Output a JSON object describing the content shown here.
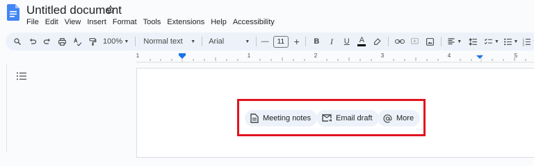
{
  "window": {
    "title": "Untitled document"
  },
  "menu": [
    "File",
    "Edit",
    "View",
    "Insert",
    "Format",
    "Tools",
    "Extensions",
    "Help",
    "Accessibility"
  ],
  "toolbar": {
    "zoom": "100%",
    "style": "Normal text",
    "font": "Arial",
    "font_size": "11",
    "minus": "—",
    "plus": "+",
    "bold": "B",
    "italic": "I",
    "underline": "U",
    "text_color": "A"
  },
  "ruler": {
    "labels": [
      "1",
      "1",
      "2",
      "3",
      "4",
      "5",
      "6"
    ]
  },
  "chips": {
    "meeting_notes": "Meeting notes",
    "email_draft": "Email draft",
    "more": "More"
  },
  "colors": {
    "accent": "#1a73e8",
    "highlight_box": "#e0141e",
    "toolbar_bg": "#edf2fa"
  }
}
